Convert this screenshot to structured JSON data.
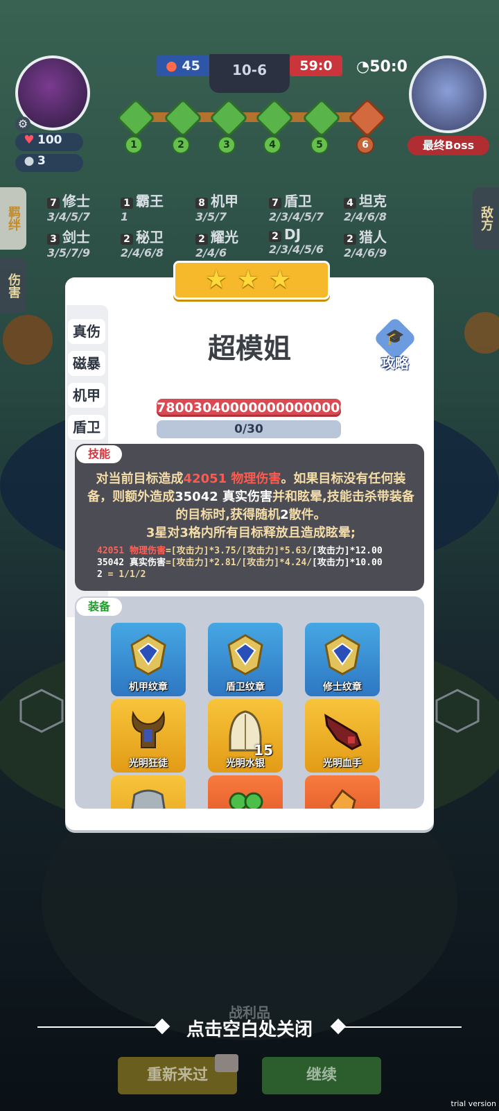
{
  "hud": {
    "hp": "100",
    "coins": "3",
    "blue_score": "45",
    "stage": "10-6",
    "red_score": "59:0",
    "timer": "50:0",
    "boss_label": "最终Boss",
    "nodes": [
      "1",
      "2",
      "3",
      "4",
      "5",
      "6"
    ]
  },
  "side_tabs": {
    "left": [
      "羁绊",
      "伤害"
    ],
    "right": "敌方"
  },
  "traits": [
    {
      "count": "7",
      "name": "修士",
      "levels": "3/4/5/7"
    },
    {
      "count": "1",
      "name": "霸王",
      "levels": "1"
    },
    {
      "count": "8",
      "name": "机甲",
      "levels": "3/5/7"
    },
    {
      "count": "7",
      "name": "盾卫",
      "levels": "2/3/4/5/7"
    },
    {
      "count": "4",
      "name": "坦克",
      "levels": "2/4/6/8"
    },
    {
      "count": "3",
      "name": "剑士",
      "levels": "3/5/7/9"
    },
    {
      "count": "2",
      "name": "秘卫",
      "levels": "2/4/6/8"
    },
    {
      "count": "2",
      "name": "耀光",
      "levels": "2/4/6"
    },
    {
      "count": "2",
      "name": "DJ",
      "levels": "2/3/4/5/6"
    },
    {
      "count": "2",
      "name": "猎人",
      "levels": "2/4/6/9"
    }
  ],
  "modal": {
    "stars": 3,
    "tabs": [
      "真伤",
      "磁暴",
      "机甲",
      "盾卫"
    ],
    "name": "超模姐",
    "guide_label": "攻略",
    "hp_value": "780030400000000000000",
    "mp_value": "0/30",
    "skill_tag": "技能",
    "skill": {
      "p1": "对当前目标造成",
      "dmg1": "42051 物理伤害",
      "p2": "。如果目标没有任何装备，则额外造成",
      "dmg2": "35042 真实伤害",
      "p3": "并和眩晕,技能击杀带装备的目标时,获得随机",
      "p4": "2",
      "p5": "散件。",
      "line2": "3星对3格内所有目标释放且造成眩晕;"
    },
    "formula": [
      {
        "head": "42051 物理伤害",
        "body": "=[攻击力]*3.75/[攻击力]*5.63/",
        "tail": "[攻击力]*12.00"
      },
      {
        "head": "35042 真实伤害",
        "body": "=[攻击力]*2.81/[攻击力]*4.24/",
        "tail": "[攻击力]*10.00"
      },
      {
        "head": "2",
        "body": " = 1/1/2",
        "tail": ""
      }
    ],
    "equip_tag": "装备",
    "items": [
      {
        "label": "机甲纹章",
        "color": "blue"
      },
      {
        "label": "盾卫纹章",
        "color": "blue"
      },
      {
        "label": "修士纹章",
        "color": "blue"
      },
      {
        "label": "光明狂徒",
        "color": "gold"
      },
      {
        "label": "光明水银",
        "color": "gold",
        "count": "15"
      },
      {
        "label": "光明血手",
        "color": "gold"
      }
    ]
  },
  "bottom": {
    "close_hint": "点击空白处关闭",
    "loot_label": "战利品",
    "retry": "重新来过",
    "continue": "继续"
  },
  "watermark": "trial version"
}
